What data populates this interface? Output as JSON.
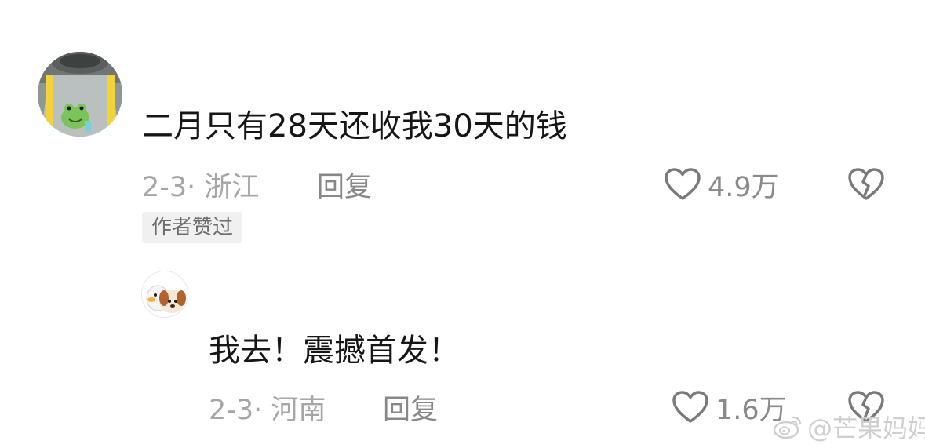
{
  "comments": [
    {
      "text": "二月只有28天还收我30天的钱",
      "meta": "2-3· 浙江",
      "reply_label": "回复",
      "likes": "4.9万",
      "badge": "作者赞过"
    }
  ],
  "reply": {
    "text": "我去！震撼首发！",
    "meta": "2-3· 河南",
    "reply_label": "回复",
    "likes": "1.6万"
  },
  "watermark": {
    "handle": "@芒果妈妈"
  },
  "icons": {
    "like": "heart-outline-icon",
    "dislike": "broken-heart-icon",
    "watermark": "weibo-logo-icon"
  },
  "colors": {
    "text_primary": "#161616",
    "text_meta": "#a6a6a6",
    "icon_stroke": "#7a7a7a",
    "badge_bg": "#f0f0f0"
  }
}
